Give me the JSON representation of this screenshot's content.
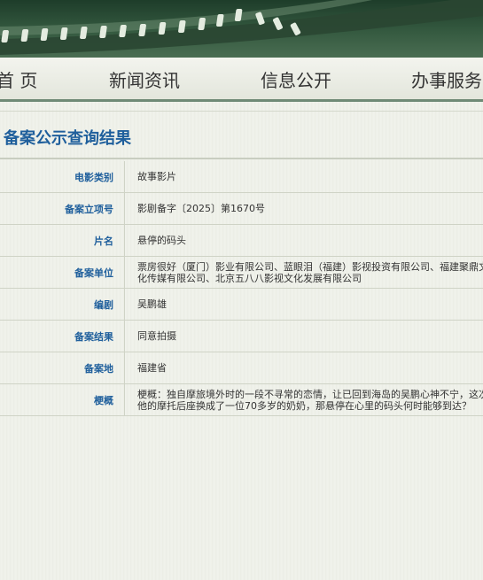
{
  "nav": {
    "items": [
      "首 页",
      "新闻资讯",
      "信息公开",
      "办事服务"
    ]
  },
  "result": {
    "title": "备案公示查询结果",
    "rows": [
      {
        "label": "电影类别",
        "value": "故事影片"
      },
      {
        "label": "备案立项号",
        "value": "影剧备字〔2025〕第1670号"
      },
      {
        "label": "片名",
        "value": "悬停的码头"
      },
      {
        "label": "备案单位",
        "value": "票房很好（厦门）影业有限公司、蓝眼泪（福建）影视投资有限公司、福建聚鼎文化传媒有限公司、北京五八八影视文化发展有限公司"
      },
      {
        "label": "编剧",
        "value": "吴鹏雄"
      },
      {
        "label": "备案结果",
        "value": "同意拍摄"
      },
      {
        "label": "备案地",
        "value": "福建省"
      },
      {
        "label": "梗概",
        "value": "梗概：独自摩旅境外时的一段不寻常的恋情，让已回到海岛的吴鹏心神不宁，这次他的摩托后座换成了一位70多岁的奶奶，那悬停在心里的码头何时能够到达？"
      }
    ]
  },
  "colors": {
    "accent": "#1f5f9c",
    "banner": "#2e4f38",
    "nav_border": "#6f8a76"
  }
}
